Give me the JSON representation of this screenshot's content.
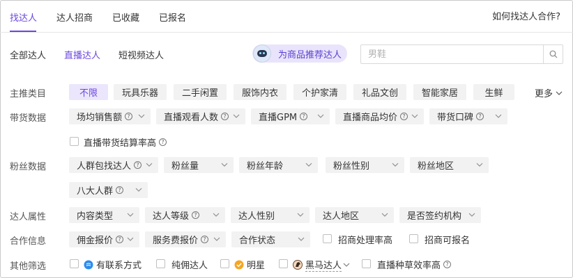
{
  "tabs": [
    "找达人",
    "达人招商",
    "已收藏",
    "已报名"
  ],
  "help_link": "如何找达人合作?",
  "subtabs": [
    "全部达人",
    "直播达人",
    "短视频达人"
  ],
  "recommend_label": "为商品推荐达人",
  "search": {
    "value": "",
    "placeholder": "男鞋"
  },
  "main_category": {
    "label": "主推类目",
    "options": [
      "不限",
      "玩具乐器",
      "二手闲置",
      "服饰内衣",
      "个护家清",
      "礼品文创",
      "智能家居",
      "生鲜"
    ],
    "selected": "不限",
    "more": "更多"
  },
  "sales_data": {
    "label": "带货数据",
    "filters": [
      "场均销售额",
      "直播观看人数",
      "直播GPM",
      "直播商品均价",
      "带货口碑"
    ],
    "checkbox": "直播带货结算率高"
  },
  "fans_data": {
    "label": "粉丝数据",
    "filters": [
      "人群包找达人",
      "粉丝量",
      "粉丝年龄",
      "粉丝性别",
      "粉丝地区",
      "八大人群"
    ]
  },
  "talent_attr": {
    "label": "达人属性",
    "filters": [
      "内容类型",
      "达人等级",
      "达人性别",
      "达人地区",
      "是否签约机构"
    ]
  },
  "coop_info": {
    "label": "合作信息",
    "filters": [
      "佣金报价",
      "服务费报价",
      "合作状态"
    ],
    "checkboxes": [
      "招商处理率高",
      "招商可报名"
    ]
  },
  "other": {
    "label": "其他筛选",
    "items": [
      "有联系方式",
      "纯佣达人",
      "明星",
      "黑马达人",
      "直播种草效率高"
    ]
  },
  "colors": {
    "accent": "#6b46e0",
    "chip_bg": "#f2f2f2",
    "selected_bg": "#ebe6fc"
  }
}
